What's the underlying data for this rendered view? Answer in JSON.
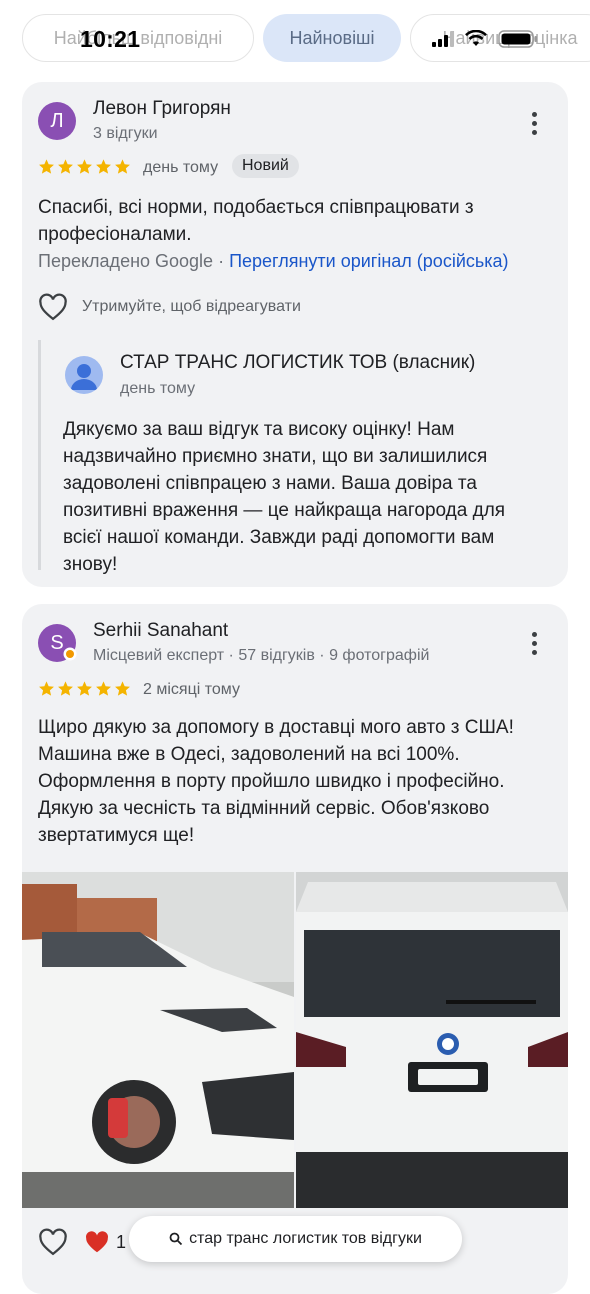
{
  "status_bar": {
    "time": "10:21"
  },
  "filters": {
    "chips": [
      {
        "label": "Найбільш відповідні"
      },
      {
        "label": "Найновіші"
      },
      {
        "label": "Найвища оцінка"
      }
    ]
  },
  "reviews": [
    {
      "avatar_letter": "Л",
      "author": "Левон Григорян",
      "meta": "3 відгуки",
      "rating": 5,
      "when": "день тому",
      "badge": "Новий",
      "text": "Спасибі, всі норми, подобається співпрацювати з професіоналами.",
      "translated_prefix": "Перекладено Google",
      "translated_separator": " · ",
      "translated_link": "Переглянути оригінал (російська)",
      "react_label": "Утримуйте, щоб відреагувати",
      "owner_reply": {
        "name": "СТАР ТРАНС ЛОГИСТИК ТОВ (власник)",
        "when": "день тому",
        "text": "Дякуємо за ваш відгук та високу оцінку! Нам надзвичайно приємно знати, що ви залишилися задоволені співпрацею з нами. Ваша довіра та позитивні враження — це найкраща нагорода для всієї нашої команди. Завжди раді допомогти вам знову!"
      }
    },
    {
      "avatar_letter": "S",
      "author": "Serhii Sanahant",
      "meta": "Місцевий експерт · 57 відгуків · 9 фотографій",
      "rating": 5,
      "when": "2 місяці тому",
      "text": "Щиро дякую за допомогу в доставці мого авто з США! Машина вже в Одесі, задоволений на всі 100%. Оформлення в порту пройшло швидко і професійно. Дякую за чесність та відмінний сервіс. Обов'язково звертатимуся ще!",
      "reaction_count": "1"
    }
  ],
  "search_pill": {
    "label": "стар транс логистик тов відгуки"
  },
  "colors": {
    "star": "#f4b400",
    "accent_link": "#1a56c9",
    "card_bg": "#f1f2f4",
    "avatar": "#8a4fb3"
  }
}
